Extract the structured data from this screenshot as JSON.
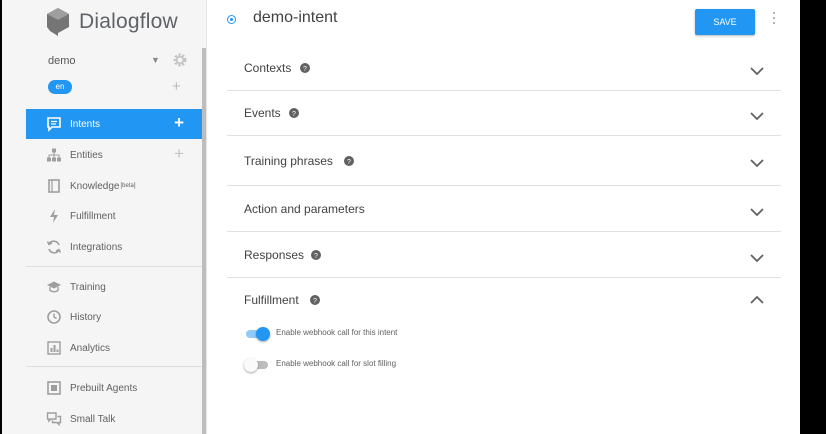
{
  "app": {
    "logo_text": "Dialogflow"
  },
  "agent": {
    "name": "demo",
    "language": "en"
  },
  "nav": {
    "items": [
      {
        "label": "Intents",
        "icon": "chat-icon",
        "active": true,
        "has_plus": true
      },
      {
        "label": "Entities",
        "icon": "sitemap-icon",
        "has_plus": true
      },
      {
        "label": "Knowledge",
        "icon": "book-icon",
        "badge": "[beta]"
      },
      {
        "label": "Fulfillment",
        "icon": "bolt-icon"
      },
      {
        "label": "Integrations",
        "icon": "sync-icon"
      },
      {
        "label": "Training",
        "icon": "graduation-cap-icon"
      },
      {
        "label": "History",
        "icon": "clock-icon"
      },
      {
        "label": "Analytics",
        "icon": "bar-chart-icon"
      },
      {
        "label": "Prebuilt Agents",
        "icon": "agents-icon"
      },
      {
        "label": "Small Talk",
        "icon": "chat-bubbles-icon"
      }
    ]
  },
  "header": {
    "intent_name": "demo-intent",
    "save_label": "SAVE"
  },
  "sections": [
    {
      "label": "Contexts",
      "has_help": true,
      "expanded": false
    },
    {
      "label": "Events",
      "has_help": true,
      "expanded": false
    },
    {
      "label": "Training phrases",
      "has_help": true,
      "expanded": false
    },
    {
      "label": "Action and parameters",
      "has_help": false,
      "expanded": false
    },
    {
      "label": "Responses",
      "has_help": true,
      "expanded": false
    },
    {
      "label": "Fulfillment",
      "has_help": true,
      "expanded": true
    }
  ],
  "fulfillment": {
    "webhook_label": "Enable webhook call for this intent",
    "webhook_enabled": true,
    "slot_label": "Enable webhook call for slot filling",
    "slot_enabled": false
  },
  "colors": {
    "accent": "#2196f3",
    "sidebar_bg": "#f5f5f5"
  }
}
